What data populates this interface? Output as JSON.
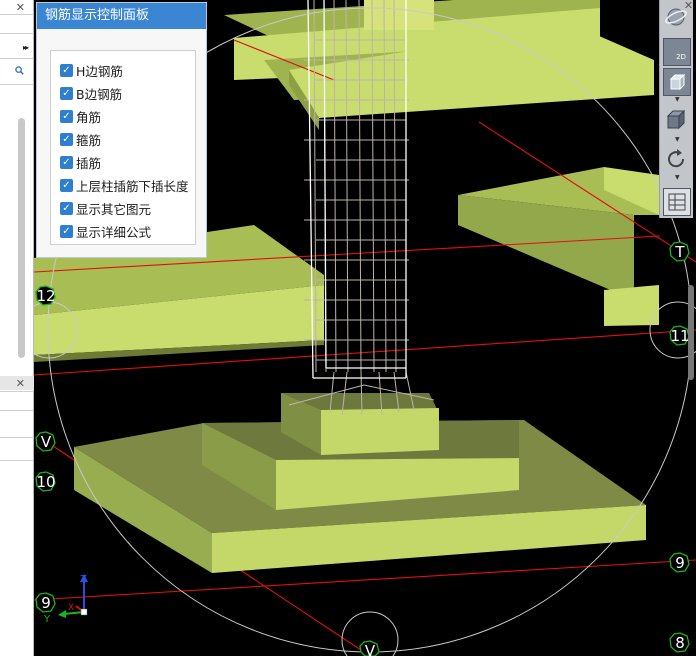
{
  "panel": {
    "title": "钢筋显示控制面板",
    "options": [
      {
        "label": "H边钢筋",
        "checked": true
      },
      {
        "label": "B边钢筋",
        "checked": true
      },
      {
        "label": "角筋",
        "checked": true
      },
      {
        "label": "箍筋",
        "checked": true
      },
      {
        "label": "插筋",
        "checked": true
      },
      {
        "label": "上层柱插筋下插长度",
        "checked": true
      },
      {
        "label": "显示其它图元",
        "checked": true
      },
      {
        "label": "显示详细公式",
        "checked": true
      }
    ]
  },
  "toolbar": {
    "view_2d_label": "2D",
    "tools": [
      "orbit-icon",
      "view-2d-icon",
      "view-3d-box-icon",
      "solid-box-icon",
      "rotate-icon",
      "layers-icon"
    ]
  },
  "axes": {
    "x": "X",
    "y": "Y",
    "z": "Z"
  },
  "grid_labels": {
    "g12": "12",
    "g11": "11",
    "g10": "10",
    "g9_left": "9",
    "g9_right": "9",
    "g8": "8",
    "gV_left": "V",
    "gV_bottom": "V",
    "gT": "T"
  },
  "colors": {
    "slab_top": "#c9dd6e",
    "slab_side": "#9fb44e",
    "footing_top": "#7e8a46",
    "footing_side": "#c4d86a",
    "grid_line": "#e01010",
    "axis_marker": "#1db31d",
    "panel_header": "#3b86d2",
    "checkbox": "#2f7fd0"
  }
}
